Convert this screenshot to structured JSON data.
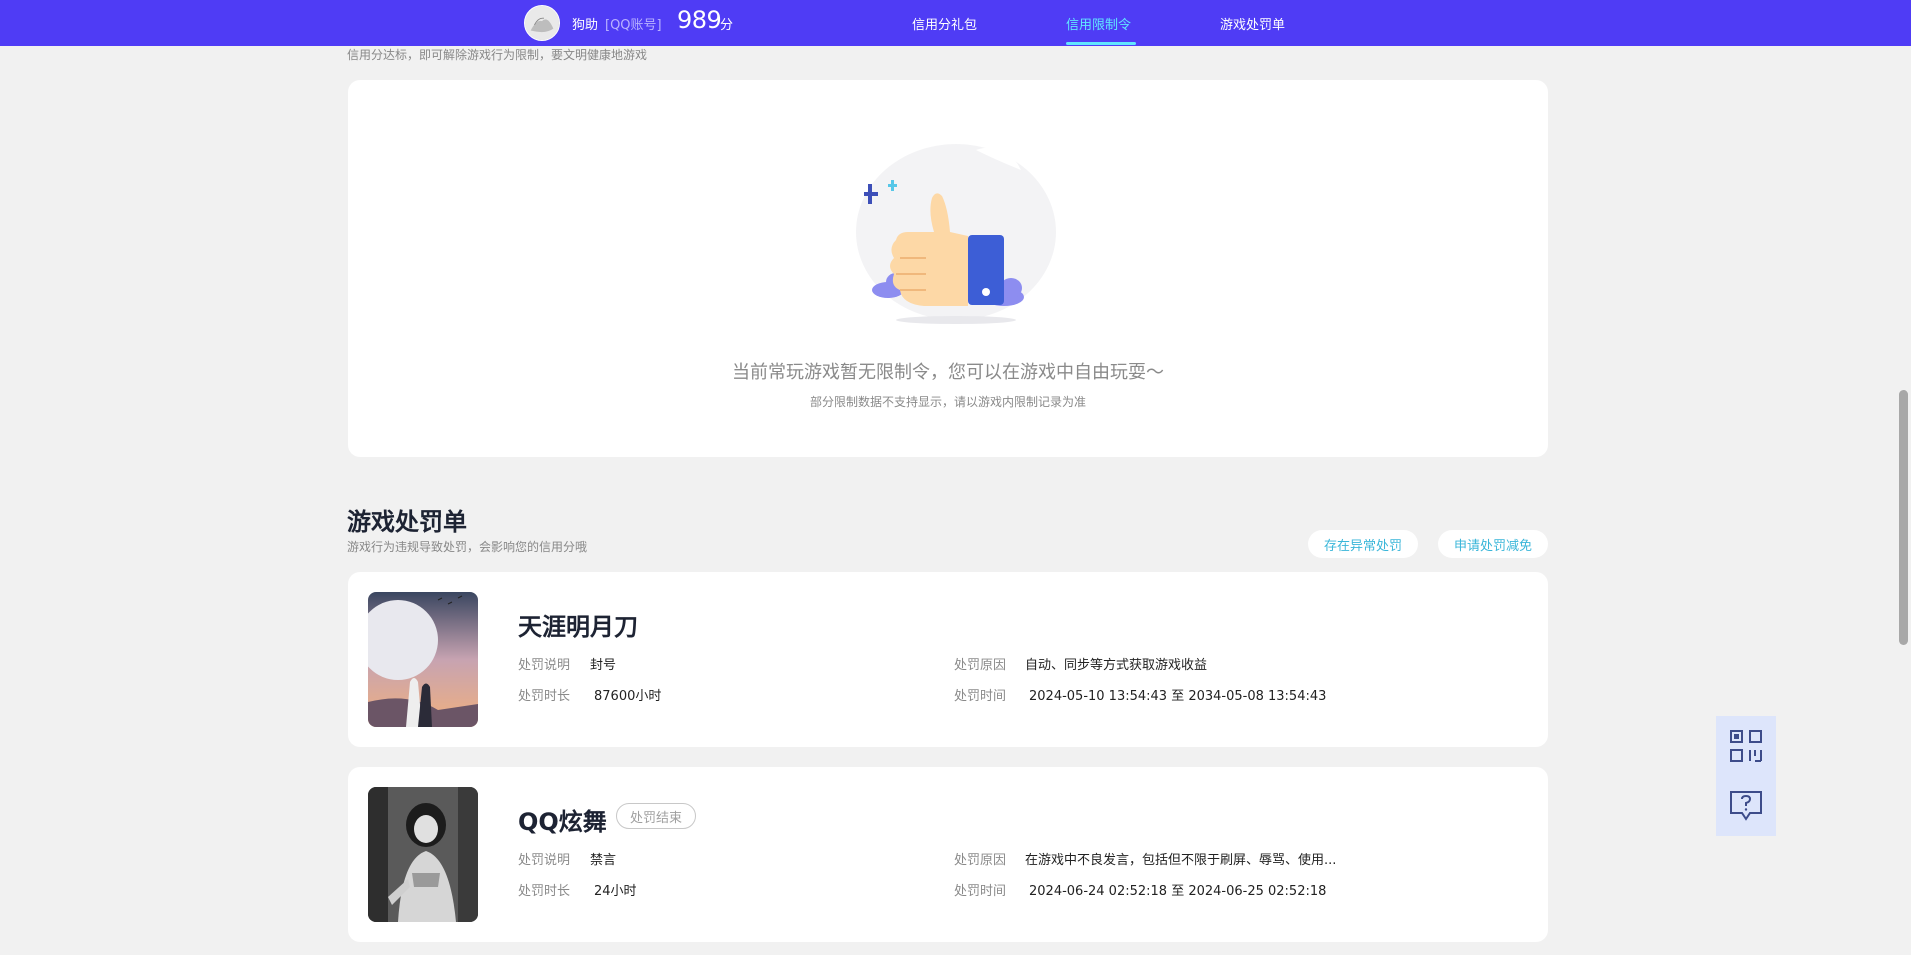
{
  "header": {
    "user_name": "狗助",
    "account_type": "[QQ账号]",
    "score": "989",
    "score_unit": "分",
    "tabs": [
      {
        "label": "信用分礼包",
        "active": false
      },
      {
        "label": "信用限制令",
        "active": true
      },
      {
        "label": "游戏处罚单",
        "active": false
      }
    ],
    "accent_color": "#4f3cf5",
    "active_color": "#61e6ff"
  },
  "restriction": {
    "subtitle": "信用分达标，即可解除游戏行为限制，要文明健康地游戏",
    "empty_title": "当前常玩游戏暂无限制令，您可以在游戏中自由玩耍～",
    "empty_note": "部分限制数据不支持显示，请以游戏内限制记录为准"
  },
  "penalty_section": {
    "title": "游戏处罚单",
    "subtitle": "游戏行为违规导致处罚，会影响您的信用分哦",
    "btn_abnormal": "存在异常处罚",
    "btn_appeal": "申请处罚减免"
  },
  "labels": {
    "desc": "处罚说明",
    "duration": "处罚时长",
    "reason": "处罚原因",
    "time": "处罚时间"
  },
  "penalties": [
    {
      "game": "天涯明月刀",
      "status": "",
      "desc": "封号",
      "duration": "87600小时",
      "reason": "自动、同步等方式获取游戏收益",
      "time": "2024-05-10 13:54:43 至 2034-05-08 13:54:43"
    },
    {
      "game": "QQ炫舞",
      "status": "处罚结束",
      "desc": "禁言",
      "duration": "24小时",
      "reason": "在游戏中不良发言，包括但不限于刷屏、辱骂、使用...",
      "time": "2024-06-24 02:52:18 至 2024-06-25 02:52:18"
    }
  ]
}
